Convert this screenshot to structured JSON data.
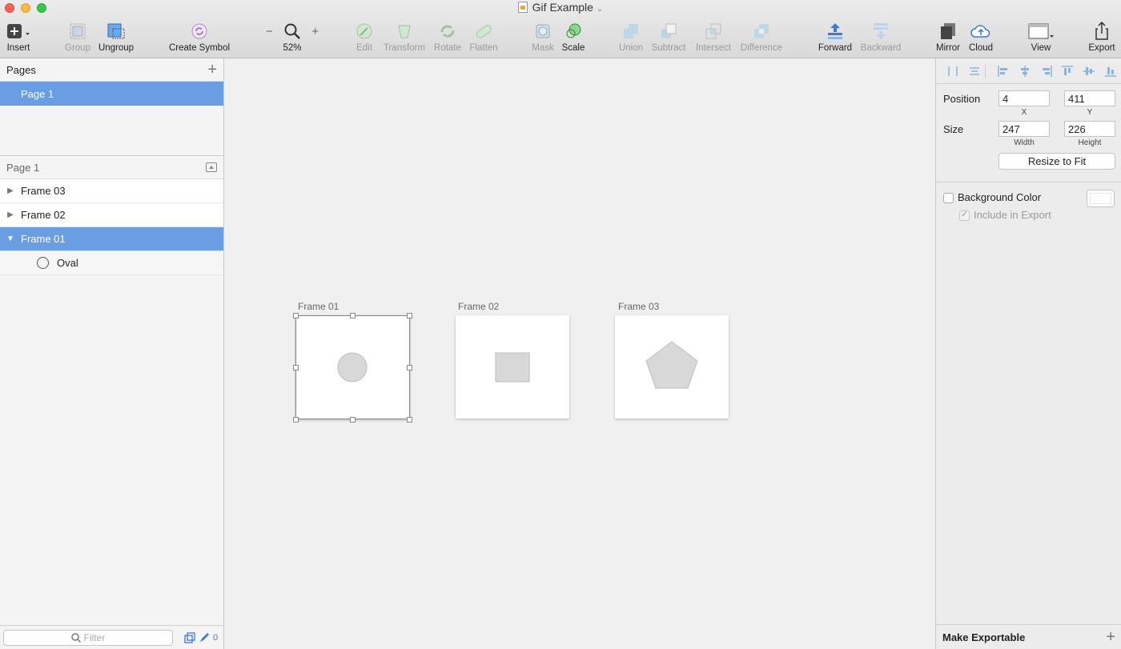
{
  "window": {
    "title": "Gif Example"
  },
  "toolbar": {
    "insert": "Insert",
    "group": "Group",
    "ungroup": "Ungroup",
    "create_symbol": "Create Symbol",
    "zoom_minus": "−",
    "zoom_plus": "+",
    "zoom_level": "52%",
    "edit": "Edit",
    "transform": "Transform",
    "rotate": "Rotate",
    "flatten": "Flatten",
    "mask": "Mask",
    "scale": "Scale",
    "union": "Union",
    "subtract": "Subtract",
    "intersect": "Intersect",
    "difference": "Difference",
    "forward": "Forward",
    "backward": "Backward",
    "mirror": "Mirror",
    "cloud": "Cloud",
    "view": "View",
    "export": "Export"
  },
  "sidebar": {
    "pages_header": "Pages",
    "pages": [
      {
        "label": "Page 1"
      }
    ],
    "layers_header": "Page 1",
    "layers": [
      {
        "label": "Frame 03"
      },
      {
        "label": "Frame 02"
      },
      {
        "label": "Frame 01"
      }
    ],
    "child_layer": "Oval",
    "filter_placeholder": "Filter",
    "edited_count": "0"
  },
  "canvas": {
    "artboards": [
      {
        "label": "Frame 01",
        "shape": "circle"
      },
      {
        "label": "Frame 02",
        "shape": "square"
      },
      {
        "label": "Frame 03",
        "shape": "pentagon"
      }
    ],
    "shape_fill": "#d8d8d8",
    "shape_stroke": "#bcbcbc"
  },
  "inspector": {
    "position_label": "Position",
    "x": "4",
    "y": "411",
    "x_caption": "X",
    "y_caption": "Y",
    "size_label": "Size",
    "width": "247",
    "height": "226",
    "width_caption": "Width",
    "height_caption": "Height",
    "resize_button": "Resize to Fit",
    "bg_color_label": "Background Color",
    "include_export_label": "Include in Export",
    "make_exportable": "Make Exportable"
  },
  "colors": {
    "selection": "#6b9de3",
    "accent_blue": "#3a7bd5"
  }
}
